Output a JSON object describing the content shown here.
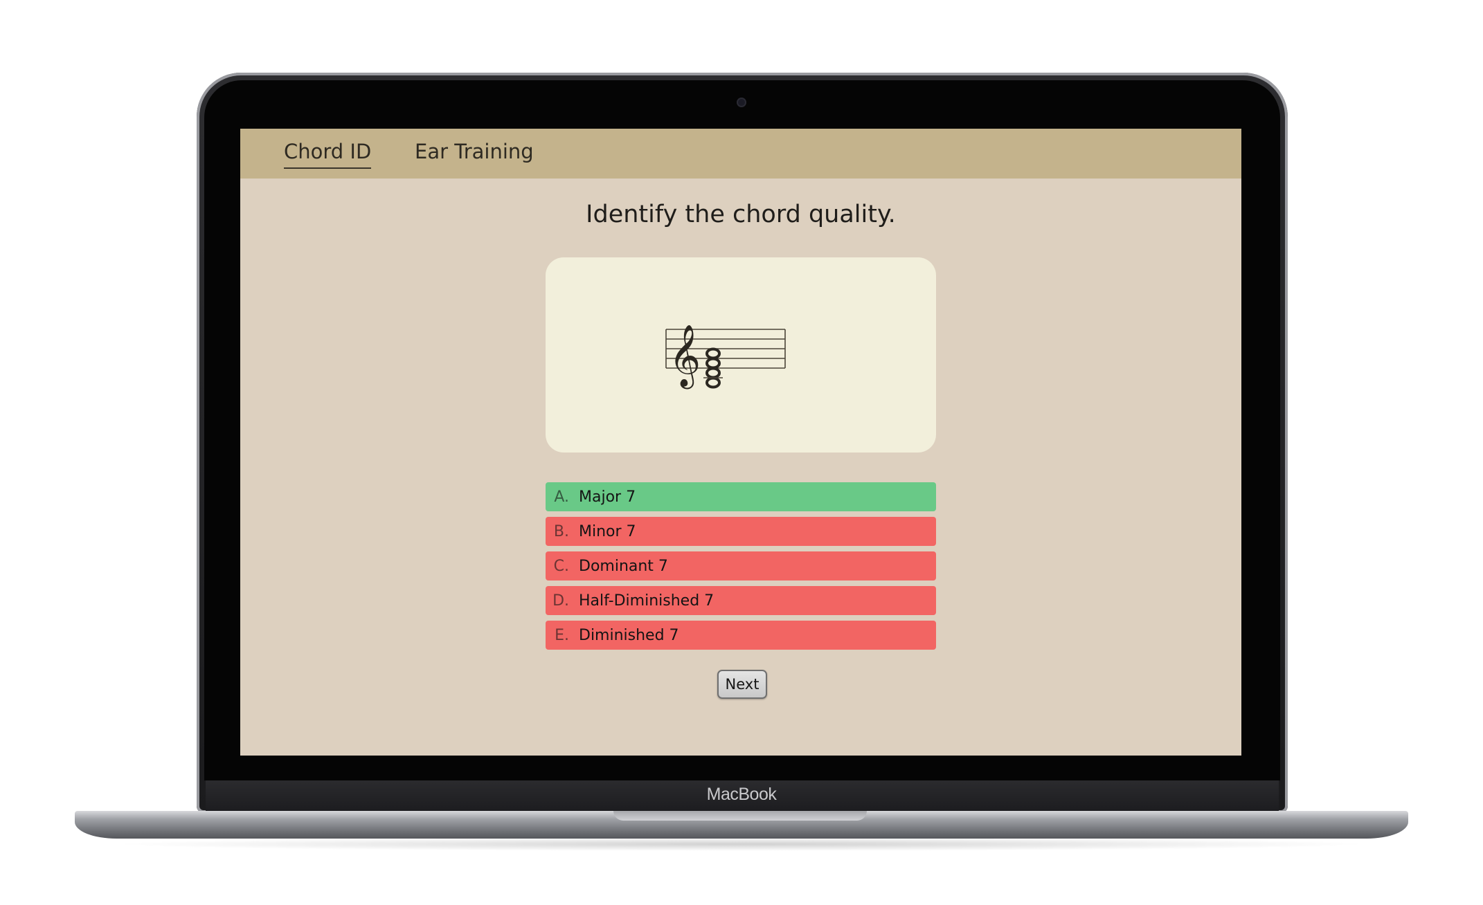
{
  "device": {
    "brand_label": "MacBook"
  },
  "nav": {
    "items": [
      {
        "label": "Chord ID",
        "active": true
      },
      {
        "label": "Ear Training",
        "active": false
      }
    ]
  },
  "quiz": {
    "prompt": "Identify the chord quality.",
    "options": [
      {
        "letter": "A.",
        "label": "Major 7",
        "state": "correct"
      },
      {
        "letter": "B.",
        "label": "Minor 7",
        "state": "wrong"
      },
      {
        "letter": "C.",
        "label": "Dominant 7",
        "state": "wrong"
      },
      {
        "letter": "D.",
        "label": "Half-Diminished 7",
        "state": "wrong"
      },
      {
        "letter": "E.",
        "label": "Diminished 7",
        "state": "wrong"
      }
    ],
    "next_label": "Next"
  },
  "colors": {
    "screen_bg": "#ddd0bf",
    "navbar_bg": "#c4b38c",
    "card_bg": "#f2efdb",
    "correct": "#69c987",
    "wrong": "#f26563"
  }
}
